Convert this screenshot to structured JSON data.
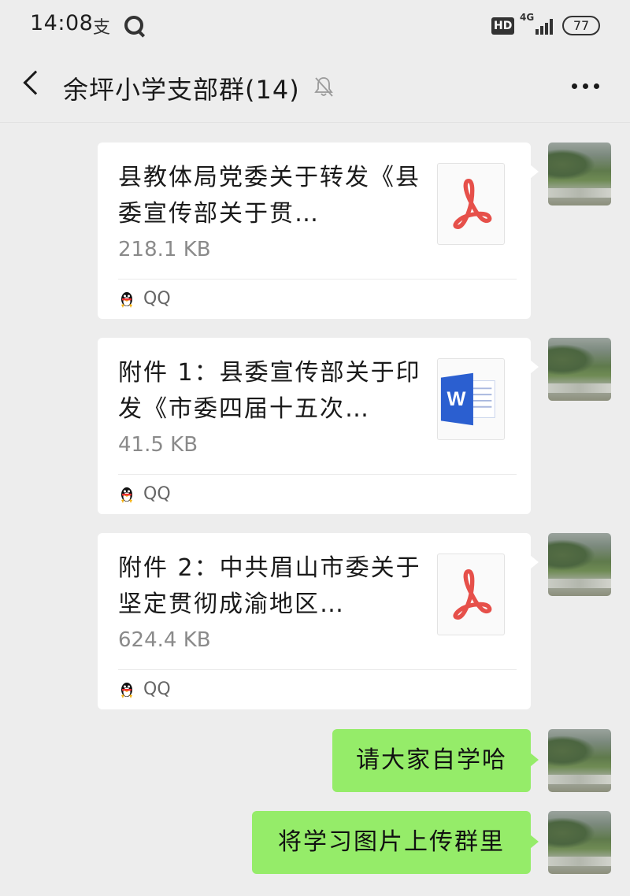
{
  "status_bar": {
    "time": "14:08",
    "app_icon_1": "支",
    "hd_badge": "HD",
    "network": "4G",
    "battery": "77"
  },
  "header": {
    "title": "余坪小学支部群(14)",
    "mute_icon": "bell-off-icon",
    "more_icon": "more-icon"
  },
  "messages": [
    {
      "type": "file",
      "title": "县教体局党委关于转发《县委宣传部关于贯…",
      "size": "218.1 KB",
      "file_icon": "pdf-icon",
      "source": "QQ"
    },
    {
      "type": "file",
      "title": "附件 1：县委宣传部关于印发《市委四届十五次…",
      "size": "41.5 KB",
      "file_icon": "word-icon",
      "source": "QQ"
    },
    {
      "type": "file",
      "title": "附件 2：中共眉山市委关于坚定贯彻成渝地区…",
      "size": "624.4 KB",
      "file_icon": "pdf-icon",
      "source": "QQ"
    },
    {
      "type": "text",
      "text": "请大家自学哈"
    },
    {
      "type": "text",
      "text": "将学习图片上传群里"
    }
  ],
  "colors": {
    "background": "#ededed",
    "sent_bubble": "#95ec69",
    "pdf_red": "#e6504a",
    "word_blue": "#2b5fd0"
  }
}
